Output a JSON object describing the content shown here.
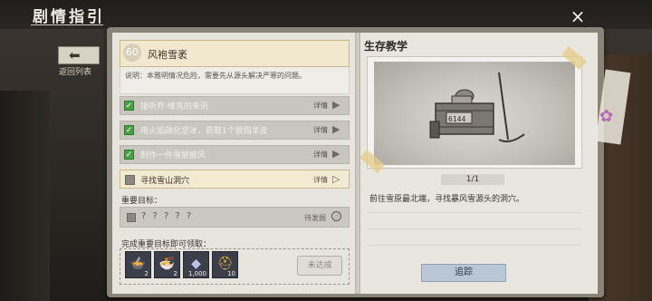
{
  "header": {
    "title": "剧情指引",
    "close_icon": "×"
  },
  "back": {
    "arrow": "⬅",
    "label": "返回列表"
  },
  "task": {
    "number": "60",
    "title": "风袍雪袤",
    "description": "说明：本雅明情况危险，需要先从源头解决严寒的问题。"
  },
  "objectives": [
    {
      "text": "接听乔·维克的来讯",
      "detail": "详情",
      "done": true
    },
    {
      "text": "用火焰融化坚冰，获取1个锐指羊皮",
      "detail": "详情",
      "done": true
    },
    {
      "text": "制作一件雪披披风",
      "detail": "详情",
      "done": true
    },
    {
      "text": "寻找雪山洞穴",
      "detail": "详情",
      "done": false
    }
  ],
  "important": {
    "label": "重要目标：",
    "text": "? ? ? ? ?",
    "pending": "待发掘"
  },
  "reward": {
    "label": "完成重要目标即可领取：",
    "items": [
      {
        "name": "hotpot-dish",
        "count": "2",
        "glyph": "🍲"
      },
      {
        "name": "spicy-dish",
        "count": "2",
        "glyph": "🍜"
      },
      {
        "name": "crystal-currency",
        "count": "1,000",
        "glyph": "◆"
      },
      {
        "name": "gold-helmet",
        "count": "10",
        "glyph": "⛑"
      }
    ],
    "button": "未达成"
  },
  "survival": {
    "title": "生存教学",
    "page": "1/1",
    "description": "前往雪原最北端，寻找暴风雪源头的洞穴。",
    "track_button": "追踪"
  }
}
